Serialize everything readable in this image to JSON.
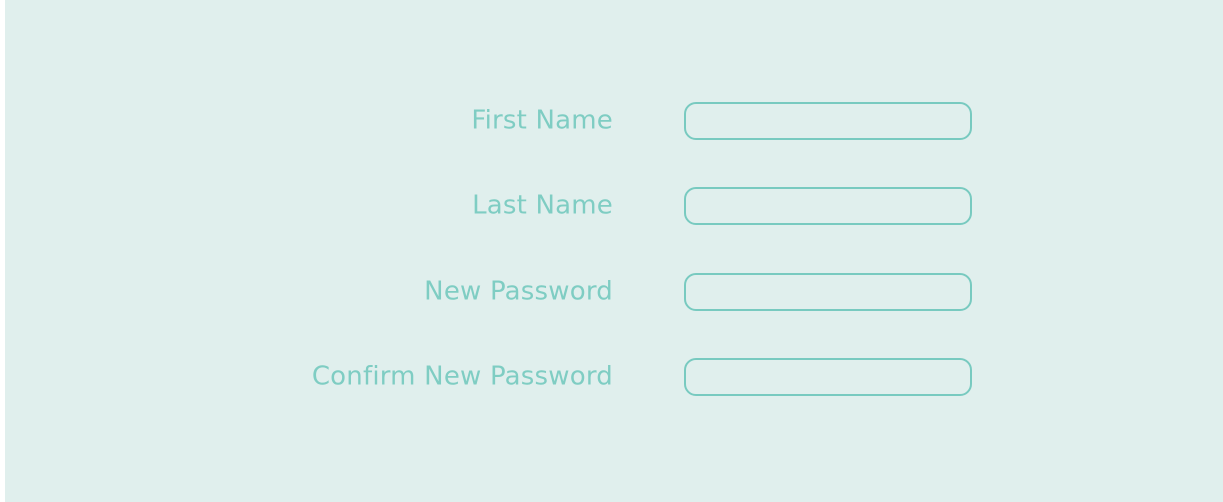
{
  "form": {
    "fields": [
      {
        "label": "First Name",
        "value": ""
      },
      {
        "label": "Last Name",
        "value": ""
      },
      {
        "label": "New Password",
        "value": ""
      },
      {
        "label": "Confirm New Password",
        "value": ""
      }
    ]
  },
  "colors": {
    "background": "#e0efed",
    "label_text": "#7fcdc3",
    "input_border": "#78cac0"
  }
}
